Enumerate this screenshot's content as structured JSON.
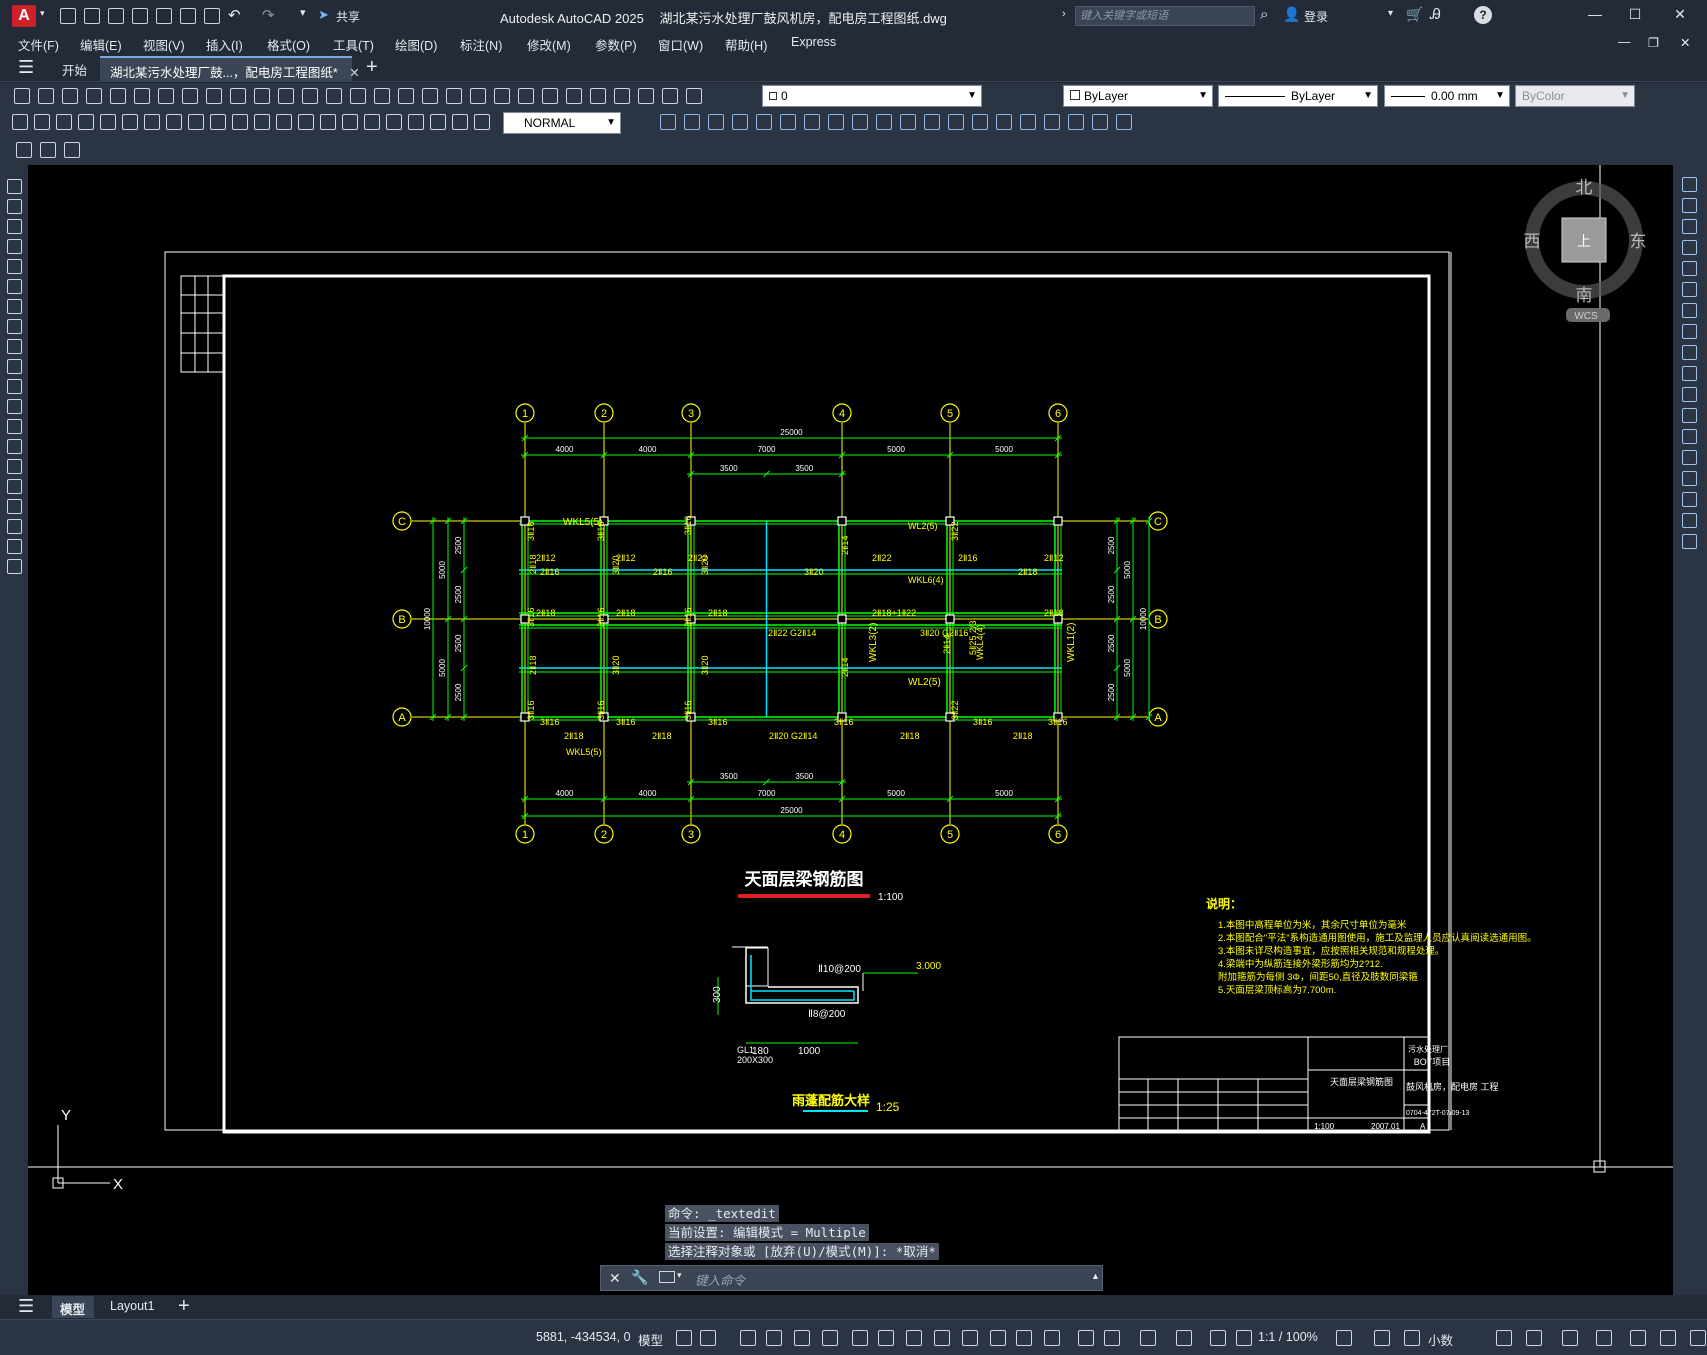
{
  "window": {
    "app_title": "Autodesk AutoCAD 2025",
    "file_title": "湖北某污水处理厂鼓风机房，配电房工程图纸.dwg",
    "share_label": "共享",
    "search_placeholder": "键入关键字或短语",
    "login_label": "登录"
  },
  "menu": [
    "文件(F)",
    "编辑(E)",
    "视图(V)",
    "插入(I)",
    "格式(O)",
    "工具(T)",
    "绘图(D)",
    "标注(N)",
    "修改(M)",
    "参数(P)",
    "窗口(W)",
    "帮助(H)",
    "Express"
  ],
  "tabs": {
    "start": "开始",
    "file": "湖北某污水处理厂鼓...，配电房工程图纸*"
  },
  "properties": {
    "layer_value": "0",
    "text_style": "NORMAL",
    "color": "ByLayer",
    "linetype": "ByLayer",
    "lineweight": "0.00 mm",
    "plotstyle": "ByColor"
  },
  "viewcube": {
    "north": "北",
    "south": "南",
    "east": "东",
    "west": "西",
    "top_face": "上",
    "wcs": "WCS"
  },
  "ucs": {
    "x": "X",
    "y": "Y"
  },
  "drawing": {
    "axes_numbered": [
      "1",
      "2",
      "3",
      "4",
      "5",
      "6"
    ],
    "axes_lettered": [
      "A",
      "B",
      "C"
    ],
    "top_total": "25000",
    "bottom_total": "25000",
    "spans": [
      "4000",
      "4000",
      "7000",
      "5000",
      "5000"
    ],
    "half_spans": [
      "3500",
      "3500"
    ],
    "side_dims_outer": [
      "2500",
      "2500",
      "2500",
      "2500"
    ],
    "side_dims_mid": [
      "5000",
      "5000"
    ],
    "side_total": "10000",
    "beam_labels": [
      "WKL5(5)",
      "WL2(5)",
      "WKL6(4)",
      "WKL3(2)",
      "WKL1(2)",
      "WKL4(4)",
      "WL2(5)",
      "WKL5(5)"
    ],
    "rebar_labels": [
      "3Ⅱ16",
      "2Ⅱ12",
      "2Ⅱ16",
      "2Ⅱ22",
      "2Ⅱ18",
      "3Ⅱ20",
      "3Ⅱ22",
      "2Ⅱ14",
      "2Ⅱ18+1Ⅱ22",
      "3Ⅱ20 G2Ⅱ16",
      "2Ⅱ22 G2Ⅱ14",
      "2Ⅱ20 G2Ⅱ14",
      "5Ⅱ25 2/3"
    ],
    "plan_title": "天面层梁钢筋图",
    "plan_scale": "1:100",
    "detail_title": "雨蓬配筋大样",
    "detail_scale": "1:25",
    "detail_labels": [
      "Ⅱ10@200",
      "Ⅱ8@200",
      "3.000",
      "300",
      "180",
      "1000",
      "GL1",
      "200X300"
    ],
    "notes_title": "说明：",
    "notes": [
      "1.本图中高程单位为米，其余尺寸单位为毫米",
      "2.本图配合\"平法\"系构造通用图使用，施工及监理人员应认真阅读选通用图。",
      "3.本图未详尽构造事宜，应按照相关规范和规程处理。",
      "4.梁端中为纵筋连接外梁形筋均为2?12.",
      "  附加箍筋为每侧 3Φ，间距50,直径及肢数同梁箍",
      "5.天面层梁顶标高为7.700m."
    ],
    "title_block": {
      "project": "污水处理厂",
      "project_sub": "BOT项目",
      "drawing_name": "天面层梁钢筋图",
      "building": "鼓风机房，配电房 工程",
      "drawing_no": "0704-472T-07/09-13",
      "scale": "1:100",
      "date": "2007.01",
      "rev": "A"
    }
  },
  "command": {
    "line1": "命令: _textedit",
    "line2": "当前设置: 编辑模式 = Multiple",
    "line3": "选择注释对象或 [放弃(U)/模式(M)]: *取消*",
    "input_placeholder": "键入命令"
  },
  "layout_tabs": [
    "模型",
    "Layout1"
  ],
  "status": {
    "coords": "5881, -434534, 0",
    "mode": "模型",
    "scale": "1:1 / 100%",
    "units": "小数"
  }
}
